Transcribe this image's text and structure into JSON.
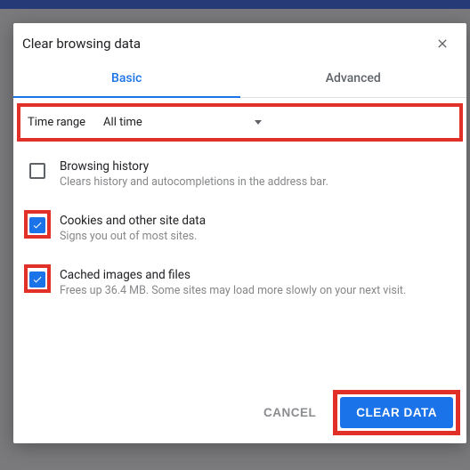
{
  "dialog": {
    "title": "Clear browsing data"
  },
  "tabs": {
    "basic": "Basic",
    "advanced": "Advanced"
  },
  "timeRange": {
    "label": "Time range",
    "value": "All time"
  },
  "options": [
    {
      "title": "Browsing history",
      "desc": "Clears history and autocompletions in the address bar.",
      "checked": false,
      "highlighted": false
    },
    {
      "title": "Cookies and other site data",
      "desc": "Signs you out of most sites.",
      "checked": true,
      "highlighted": true
    },
    {
      "title": "Cached images and files",
      "desc": "Frees up 36.4 MB. Some sites may load more slowly on your next visit.",
      "checked": true,
      "highlighted": true
    }
  ],
  "footer": {
    "cancel": "CANCEL",
    "clear": "CLEAR DATA"
  }
}
